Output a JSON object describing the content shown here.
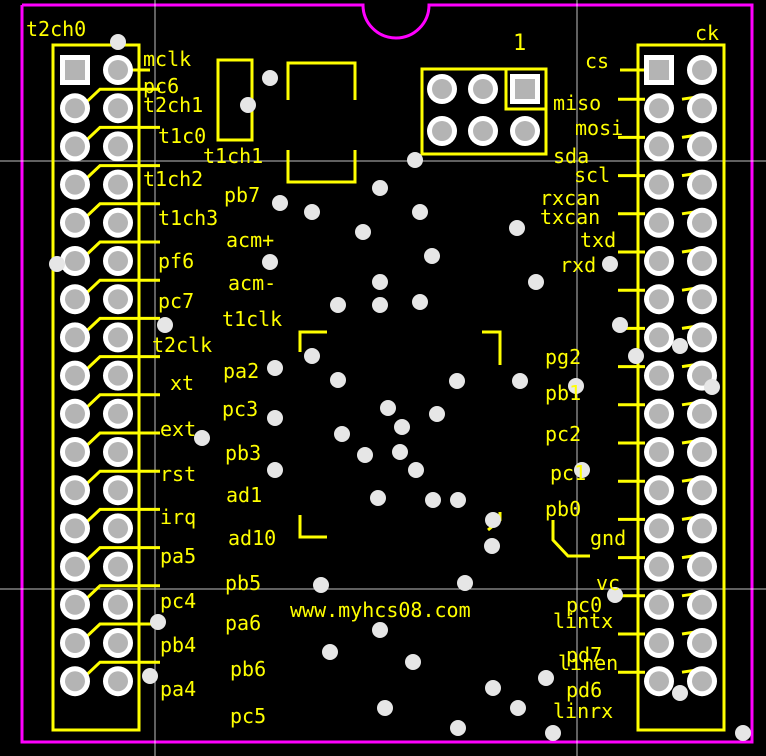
{
  "board": {
    "url_text": "www.myhcs08.com",
    "header_marker": "1",
    "left_header_title": "t2ch0",
    "right_header_title": "ck",
    "colors": {
      "background": "#000000",
      "outline": "#ff00ff",
      "silkscreen": "#ffff00",
      "pad": "#b4b4b4",
      "via": "#e6e6e6",
      "grid": "#ffffff"
    }
  },
  "left_labels": [
    "mclk",
    "pc6",
    "t2ch1",
    "t1c0",
    "t1ch1",
    "t1ch2",
    "pb7",
    "t1ch3",
    "acm+",
    "pf6",
    "acm-",
    "pc7",
    "t1clk",
    "t2clk",
    "pa2",
    "xt",
    "pc3",
    "ext",
    "pb3",
    "rst",
    "ad1",
    "irq",
    "ad10",
    "pa5",
    "pb5",
    "pc4",
    "pa6",
    "pb4",
    "pb6",
    "pa4",
    "pc5"
  ],
  "right_labels": [
    "cs",
    "miso",
    "mosi",
    "sda",
    "scl",
    "rxcan",
    "txcan",
    "txd",
    "rxd",
    "pg2",
    "pb1",
    "pc2",
    "pc1",
    "pb0",
    "gnd",
    "vc",
    "pc0",
    "lintx",
    "pd7",
    "linen",
    "pd6",
    "linrx"
  ]
}
